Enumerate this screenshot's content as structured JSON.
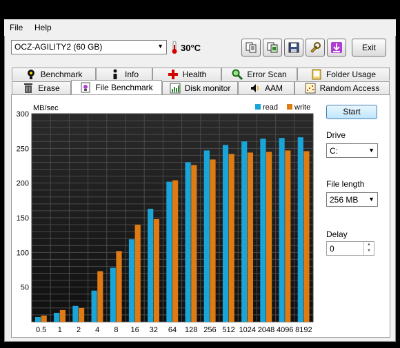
{
  "menu": {
    "file": "File",
    "help": "Help"
  },
  "toolbar": {
    "drive": "OCZ-AGILITY2 (60 GB)",
    "temperature": "30°C",
    "exit_label": "Exit",
    "buttons": [
      "copy-icon",
      "copy-screen-icon",
      "save-icon",
      "tools-icon",
      "download-icon"
    ]
  },
  "tabs_top": [
    "Benchmark",
    "Info",
    "Health",
    "Error Scan",
    "Folder Usage"
  ],
  "tabs_bottom": [
    "Erase",
    "File Benchmark",
    "Disk monitor",
    "AAM",
    "Random Access"
  ],
  "active_tab": "File Benchmark",
  "side": {
    "start_label": "Start",
    "drive_label": "Drive",
    "drive_value": "C:",
    "file_length_label": "File length",
    "file_length_value": "256 MB",
    "delay_label": "Delay",
    "delay_value": "0"
  },
  "colors": {
    "read": "#1aa5d8",
    "write": "#e07a12",
    "plot_bg": "#1e1e1e"
  },
  "chart_data": {
    "type": "bar",
    "ylabel": "MB/sec",
    "ylim": [
      0,
      300
    ],
    "yticks": [
      50,
      100,
      150,
      200,
      250,
      300
    ],
    "categories": [
      "0.5",
      "1",
      "2",
      "4",
      "8",
      "16",
      "32",
      "64",
      "128",
      "256",
      "512",
      "1024",
      "2048",
      "4096",
      "8192"
    ],
    "series": [
      {
        "name": "read",
        "values": [
          7,
          13,
          23,
          45,
          78,
          119,
          163,
          202,
          230,
          247,
          255,
          260,
          264,
          265,
          266
        ]
      },
      {
        "name": "write",
        "values": [
          9,
          17,
          20,
          73,
          102,
          140,
          148,
          204,
          226,
          234,
          242,
          244,
          245,
          247,
          246
        ]
      }
    ],
    "legend_position": "top-right",
    "grid": true
  }
}
